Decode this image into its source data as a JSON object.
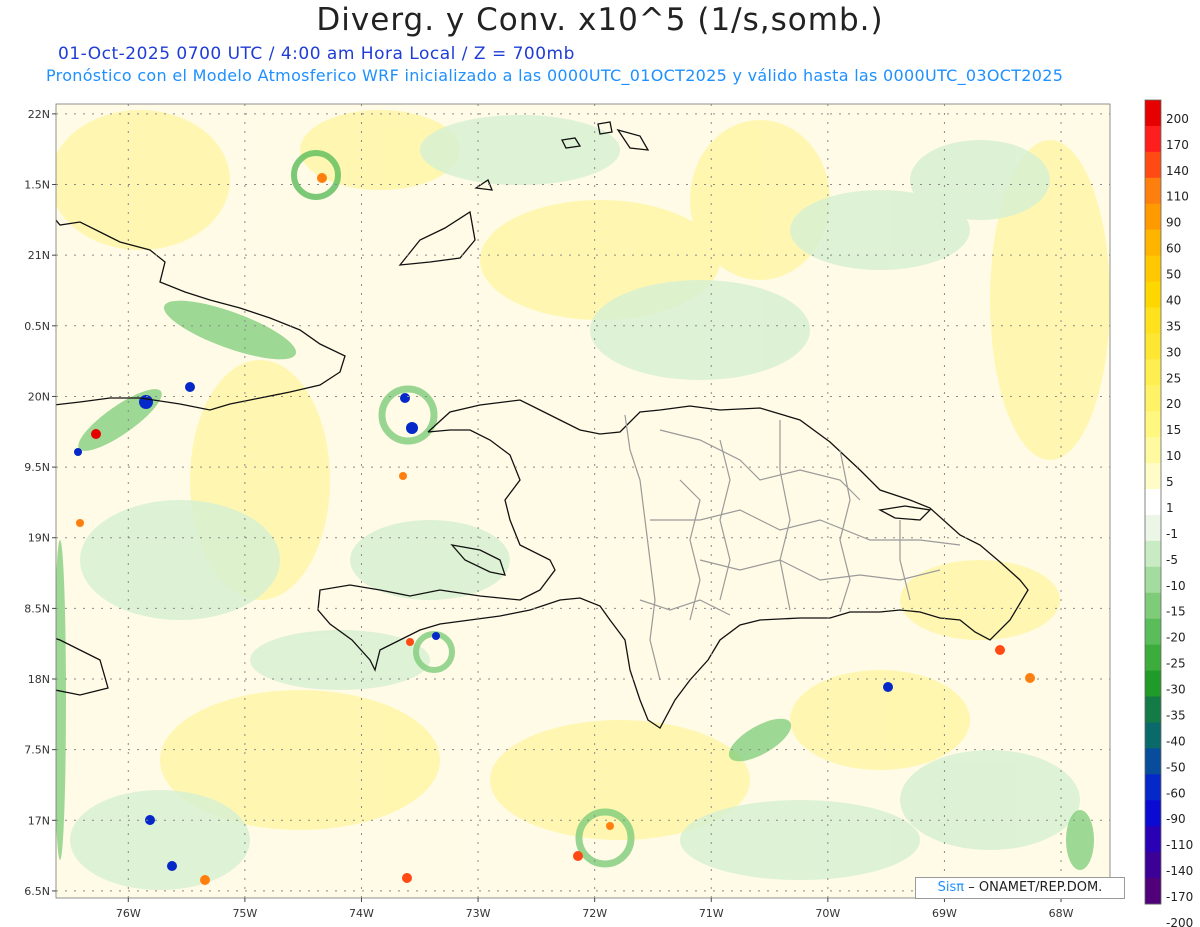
{
  "header": {
    "title": "Diverg. y Conv. x10^5 (1/s,somb.)",
    "line1": "01-Oct-2025  0700 UTC / 4:00 am Hora Local / Z = 700mb",
    "line2": "Pronóstico con el Modelo Atmosferico WRF inicializado a las 0000UTC_01OCT2025 y válido hasta las  0000UTC_03OCT2025"
  },
  "map": {
    "lat_labels": [
      "22N",
      "1.5N",
      "21N",
      "0.5N",
      "20N",
      "9.5N",
      "19N",
      "8.5N",
      "18N",
      "7.5N",
      "17N",
      "6.5N"
    ],
    "lon_labels": [
      "76W",
      "75W",
      "74W",
      "73W",
      "72W",
      "71W",
      "70W",
      "69W",
      "68W"
    ],
    "lat_values": [
      22,
      21.5,
      21,
      20.5,
      20,
      19.5,
      19,
      18.5,
      18,
      17.5,
      17,
      16.5
    ],
    "lon_values": [
      -76,
      -75,
      -74,
      -73,
      -72,
      -71,
      -70,
      -69,
      -68
    ],
    "lon_range": [
      -76.62,
      -67.58
    ],
    "lat_range": [
      16.45,
      22.07
    ],
    "grid": true,
    "field": "divergence/convergence shading"
  },
  "colorbar": {
    "labels": [
      "200",
      "170",
      "140",
      "110",
      "90",
      "60",
      "50",
      "40",
      "35",
      "30",
      "25",
      "20",
      "15",
      "10",
      "5",
      "1",
      "-1",
      "-5",
      "-10",
      "-15",
      "-20",
      "-25",
      "-30",
      "-35",
      "-40",
      "-50",
      "-60",
      "-90",
      "-110",
      "-140",
      "-170",
      "-200"
    ],
    "colors": [
      "#e60000",
      "#ff1e1e",
      "#ff4a14",
      "#ff7f0e",
      "#ff9b00",
      "#ffb400",
      "#ffc800",
      "#ffd700",
      "#ffe11e",
      "#ffe632",
      "#ffee50",
      "#fff266",
      "#fff780",
      "#fffaa0",
      "#fffcc8",
      "#ffffff",
      "#ebf6e6",
      "#c8ebc3",
      "#a4dca0",
      "#7ecc7a",
      "#5abd5a",
      "#3cad3c",
      "#1e9b28",
      "#147a46",
      "#0a6a6a",
      "#084c9c",
      "#0628c8",
      "#0a0ad2",
      "#2a00b4",
      "#3c0096",
      "#500078"
    ]
  },
  "credit": {
    "sis": "Sisπ",
    "rest": "– ONAMET/REP.DOM."
  }
}
